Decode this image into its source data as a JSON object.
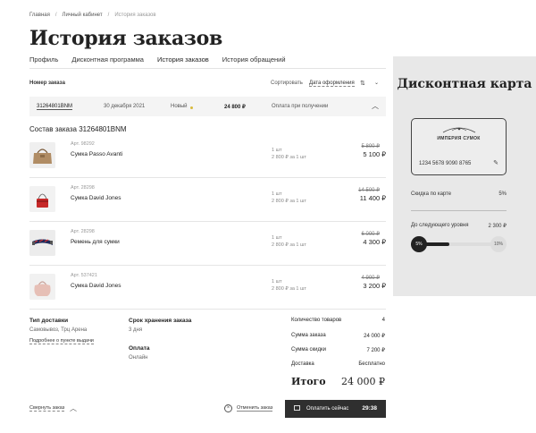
{
  "breadcrumbs": [
    "Главная",
    "Личный кабинет",
    "История заказов"
  ],
  "page_title": "История заказов",
  "tabs": [
    {
      "label": "Профиль"
    },
    {
      "label": "Дисконтная программа"
    },
    {
      "label": "История заказов"
    },
    {
      "label": "История обращений"
    }
  ],
  "list_header": {
    "order_number": "Номер заказа",
    "sort": "Сортировать",
    "date": "Дата оформления"
  },
  "order": {
    "number": "31264801BNM",
    "date": "30 декабря 2021",
    "status": "Новый",
    "sum": "24 800 ₽",
    "payment": "Оплата при получении"
  },
  "composition_title": "Состав заказа 31264801BNM",
  "items": [
    {
      "art": "Арт. 98292",
      "name": "Сумка Passo Avanti",
      "qty": "1 шт",
      "unit": "2 800 ₽ за 1 шт",
      "old_price": "5 800 ₽",
      "price": "5 100 ₽"
    },
    {
      "art": "Арт. 28298",
      "name": "Сумка David Jones",
      "qty": "1 шт",
      "unit": "2 800 ₽ за 1 шт",
      "old_price": "14 500 ₽",
      "price": "11 400 ₽"
    },
    {
      "art": "Арт. 28298",
      "name": "Ремень для сумки",
      "qty": "1 шт",
      "unit": "2 800 ₽ за 1 шт",
      "old_price": "6 000 ₽",
      "price": "4 300 ₽"
    },
    {
      "art": "Арт. 537421",
      "name": "Сумка David Jones",
      "qty": "1 шт",
      "unit": "2 800 ₽ за 1 шт",
      "old_price": "4 900 ₽",
      "price": "3 200 ₽"
    }
  ],
  "delivery": {
    "title": "Тип доставки",
    "value": "Самовывоз, Трц Арена",
    "link": "Подробнее о пункте выдачи"
  },
  "storage": {
    "title": "Срок хранения заказа",
    "value": "3 дня"
  },
  "payment": {
    "title": "Оплата",
    "value": "Онлайн"
  },
  "totals": {
    "count_label": "Количество товаров",
    "count": "4",
    "sum_label": "Сумма заказа",
    "sum": "24 000 ₽",
    "discount_label": "Сумма скидки",
    "discount": "7 200 ₽",
    "delivery_label": "Доставка",
    "delivery": "Бесплатно",
    "total_label": "Итого",
    "total": "24 000 ₽"
  },
  "footer": {
    "collapse": "Свернуть заказ",
    "cancel": "Отменить заказ",
    "pay": "Оплатить сейчас",
    "timer": "29:38"
  },
  "discount_card": {
    "title": "Дисконтная карта",
    "brand": "ИМПЕРИЯ СУМОК",
    "card_number": "1234 5678 9090 8765",
    "discount_label": "Скидка по карте",
    "discount_value": "5%",
    "next_label": "До следующего уровня",
    "next_value": "2 300 ₽",
    "level_from": "5%",
    "level_to": "10%",
    "progress": 0.4
  },
  "colors": {
    "accent_dark": "#2f2f2f",
    "panel_bg": "#e8e8e8",
    "status_dot": "#d8b93a"
  }
}
